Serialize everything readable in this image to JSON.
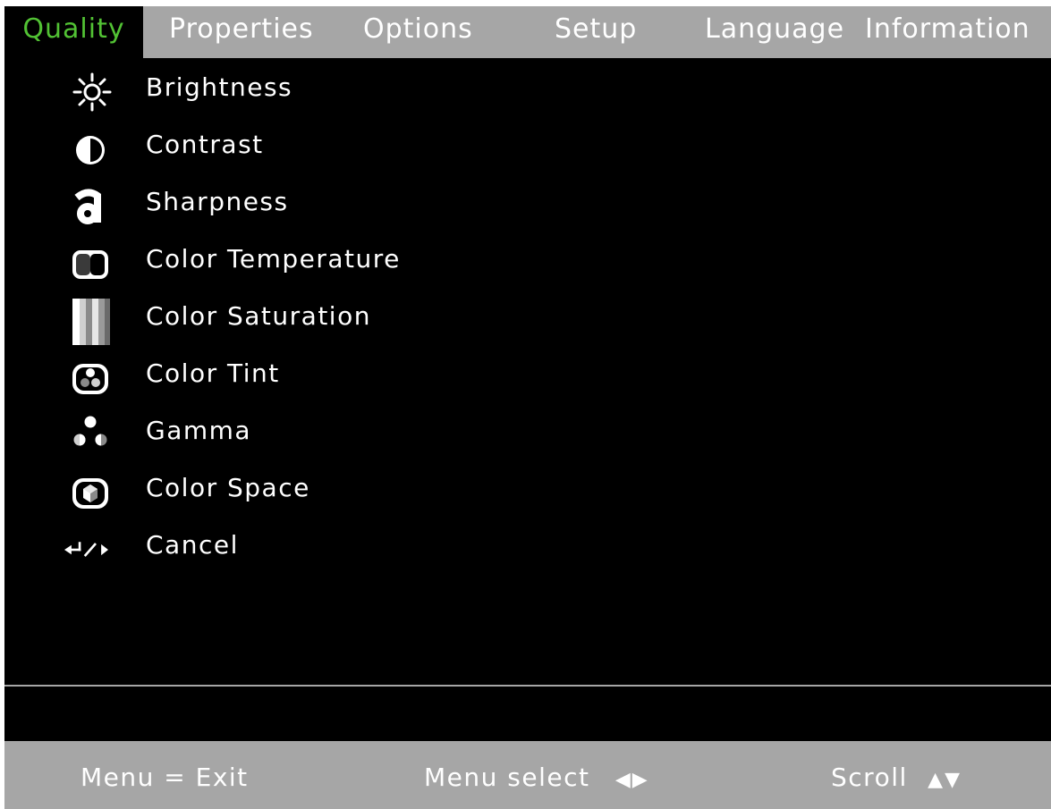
{
  "colors": {
    "background": "#000000",
    "bar": "#a6a6a6",
    "text": "#ffffff",
    "active_tab_text": "#52c234"
  },
  "tabs": [
    {
      "label": "Quality",
      "active": true
    },
    {
      "label": "Properties",
      "active": false
    },
    {
      "label": "Options",
      "active": false
    },
    {
      "label": "Setup",
      "active": false
    },
    {
      "label": "Language",
      "active": false
    },
    {
      "label": "Information",
      "active": false
    }
  ],
  "menu": {
    "items": [
      {
        "label": "Brightness",
        "icon": "brightness-sun-icon"
      },
      {
        "label": "Contrast",
        "icon": "contrast-half-circle-icon"
      },
      {
        "label": "Sharpness",
        "icon": "sharpness-letter-a-icon"
      },
      {
        "label": "Color Temperature",
        "icon": "color-temperature-screen-icon"
      },
      {
        "label": "Color Saturation",
        "icon": "color-saturation-bars-icon"
      },
      {
        "label": "Color Tint",
        "icon": "color-tint-circles-icon"
      },
      {
        "label": "Gamma",
        "icon": "gamma-dots-icon"
      },
      {
        "label": "Color Space",
        "icon": "color-space-cube-icon"
      },
      {
        "label": "Cancel",
        "icon": "enter-slash-right-icon"
      }
    ]
  },
  "footer": {
    "exit_hint": "Menu = Exit",
    "select_hint": "Menu select",
    "select_glyph": "◀▶",
    "scroll_hint": "Scroll",
    "scroll_glyph": "▲▼"
  }
}
